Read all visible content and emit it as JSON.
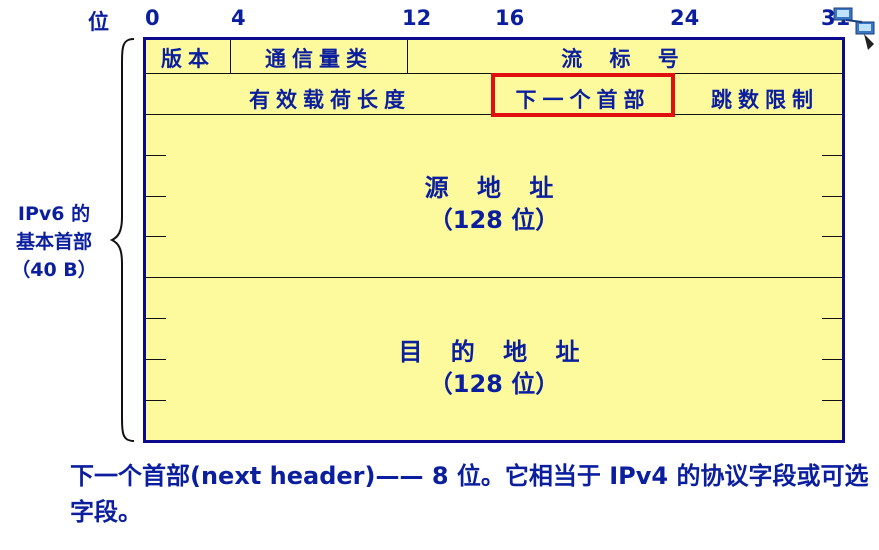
{
  "bit_axis": {
    "label": "位",
    "ticks": [
      "0",
      "4",
      "12",
      "16",
      "24",
      "31"
    ]
  },
  "header": {
    "row1": {
      "version": "版本",
      "traffic_class": "通信量类",
      "flow_label": "流 标 号"
    },
    "row2": {
      "payload_length": "有效载荷长度",
      "next_header": "下一个首部",
      "hop_limit": "跳数限制"
    },
    "source": {
      "name": "源 地 址",
      "size": "（128 位）"
    },
    "destination": {
      "name": "目 的 地 址",
      "size": "（128 位）"
    }
  },
  "side_label": {
    "line1": "IPv6 的",
    "line2": "基本首部",
    "line3": "（40 B）"
  },
  "note": "下一个首部(next header)—— 8 位。它相当于 IPv4 的协议字段或可选字段。",
  "colors": {
    "text": "#0b1f9e",
    "box_fill": "#fcfa9c",
    "highlight": "#e01010"
  }
}
